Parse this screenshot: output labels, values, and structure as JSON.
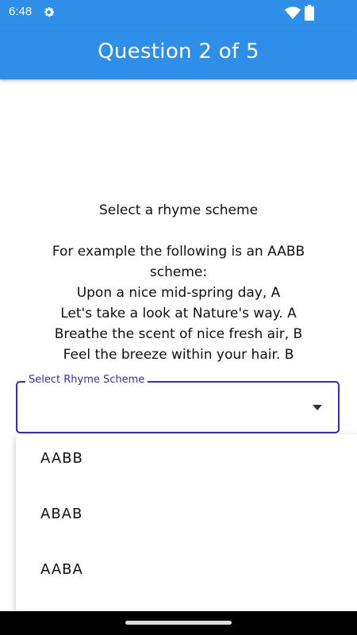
{
  "status_bar": {
    "time": "6:48",
    "icons": [
      "gear-icon",
      "wifi-icon",
      "battery-icon"
    ],
    "color": "#2f8fe8"
  },
  "app_bar": {
    "title": "Question 2 of 5",
    "color": "#2f8fe8"
  },
  "question": {
    "prompt": "Select a rhyme scheme",
    "lines": [
      "For example the following is an AABB",
      "scheme:",
      "Upon a nice mid-spring day, A",
      "Let's take a look at Nature's way. A",
      "Breathe the scent of nice fresh air, B",
      "Feel the breeze within your hair. B"
    ]
  },
  "select": {
    "label": "Select Rhyme Scheme",
    "value": "",
    "accent_color": "#3a2bb3",
    "options": [
      "AABB",
      "ABAB",
      "AABA"
    ]
  }
}
